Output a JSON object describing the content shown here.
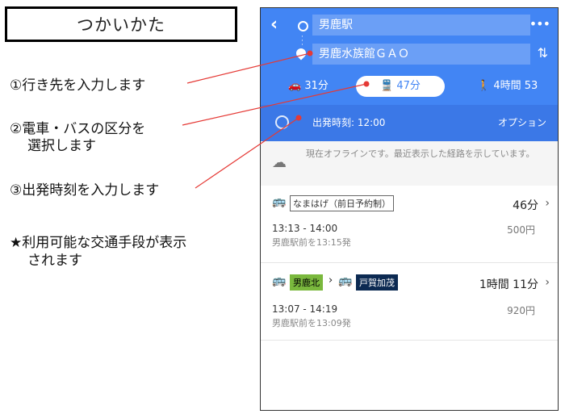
{
  "instructions": {
    "title": "つかいかた",
    "steps": [
      "①行き先を入力します",
      "②電車・バスの区分を",
      "選択します",
      "③出発時刻を入力します",
      "★利用可能な交通手段が表示",
      "されます"
    ]
  },
  "app": {
    "origin": "男鹿駅",
    "destination": "男鹿水族館ＧＡＯ",
    "modes": [
      {
        "icon": "car-icon",
        "label": "31分"
      },
      {
        "icon": "train-icon",
        "label": "47分",
        "selected": true
      },
      {
        "icon": "walk-icon",
        "label": "4時間 53"
      }
    ],
    "departure": "出発時刻: 12:00",
    "options_label": "オプション",
    "offline_message": "現在オフラインです。最近表示した経路を示しています。",
    "routes": [
      {
        "lines": [
          "なまはげ（前日予約制）"
        ],
        "duration": "46分",
        "time_range": "13:13 - 14:00",
        "departure_note": "男鹿駅前を13:15発",
        "fare": "500円"
      },
      {
        "lines": [
          "男鹿北",
          "戸賀加茂"
        ],
        "duration": "1時間 11分",
        "time_range": "13:07 - 14:19",
        "departure_note": "男鹿駅前を13:09発",
        "fare": "920円"
      }
    ]
  },
  "colors": {
    "header": "#4285f4",
    "time_bar": "#3b78e7",
    "annotation_line": "#e53935",
    "tag_green": "#7ab83d",
    "tag_navy": "#0c2a52"
  }
}
